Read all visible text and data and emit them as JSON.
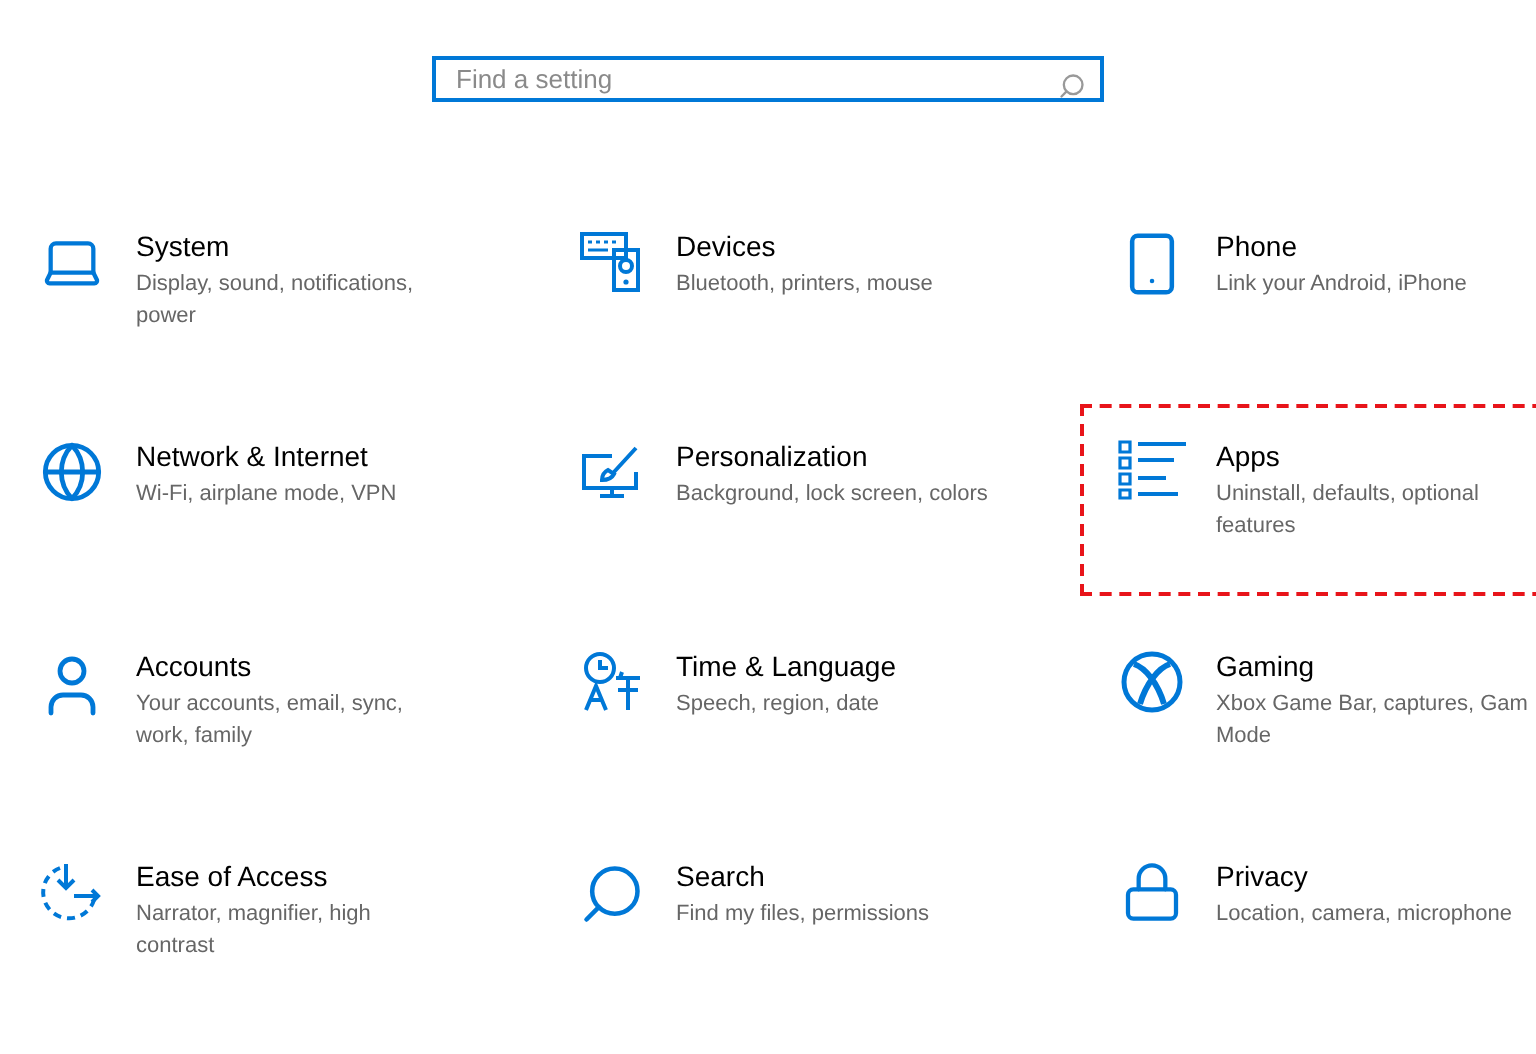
{
  "search": {
    "placeholder": "Find a setting"
  },
  "categories": [
    {
      "kind": "system",
      "title": "System",
      "description": "Display, sound, notifications, power",
      "highlighted": false
    },
    {
      "kind": "devices",
      "title": "Devices",
      "description": "Bluetooth, printers, mouse",
      "highlighted": false
    },
    {
      "kind": "phone",
      "title": "Phone",
      "description": "Link your Android, iPhone",
      "highlighted": false
    },
    {
      "kind": "network",
      "title": "Network & Internet",
      "description": "Wi-Fi, airplane mode, VPN",
      "highlighted": false
    },
    {
      "kind": "personalization",
      "title": "Personalization",
      "description": "Background, lock screen, colors",
      "highlighted": false
    },
    {
      "kind": "apps",
      "title": "Apps",
      "description": "Uninstall, defaults, optional features",
      "highlighted": true
    },
    {
      "kind": "accounts",
      "title": "Accounts",
      "description": "Your accounts, email, sync, work, family",
      "highlighted": false
    },
    {
      "kind": "time",
      "title": "Time & Language",
      "description": "Speech, region, date",
      "highlighted": false
    },
    {
      "kind": "gaming",
      "title": "Gaming",
      "description": "Xbox Game Bar, captures, Gam Mode",
      "highlighted": false
    },
    {
      "kind": "ease",
      "title": "Ease of Access",
      "description": "Narrator, magnifier, high contrast",
      "highlighted": false
    },
    {
      "kind": "search",
      "title": "Search",
      "description": "Find my files, permissions",
      "highlighted": false
    },
    {
      "kind": "privacy",
      "title": "Privacy",
      "description": "Location, camera, microphone",
      "highlighted": false
    }
  ]
}
